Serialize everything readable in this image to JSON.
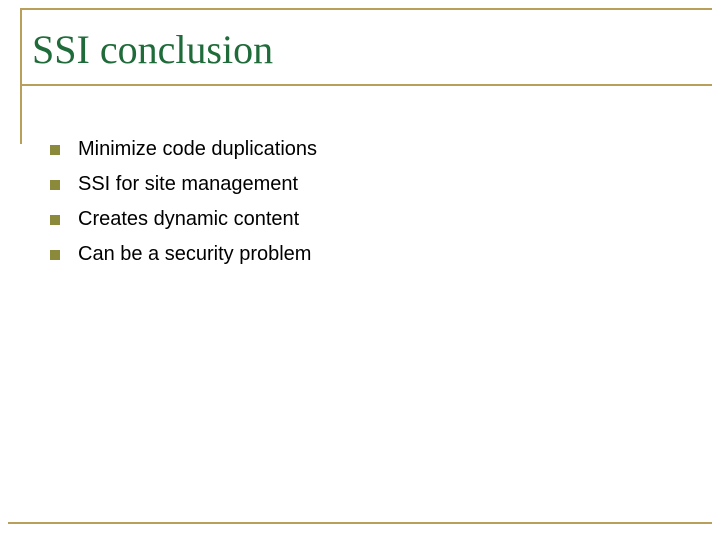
{
  "title": "SSI conclusion",
  "bullets": [
    {
      "label": "Minimize code duplications"
    },
    {
      "label": "SSI for site management"
    },
    {
      "label": "Creates dynamic content"
    },
    {
      "label": "Can be a security problem"
    }
  ],
  "colors": {
    "accent": "#b8a05a",
    "titleText": "#1f6b3a",
    "bulletSquare": "#8a8a3a"
  }
}
